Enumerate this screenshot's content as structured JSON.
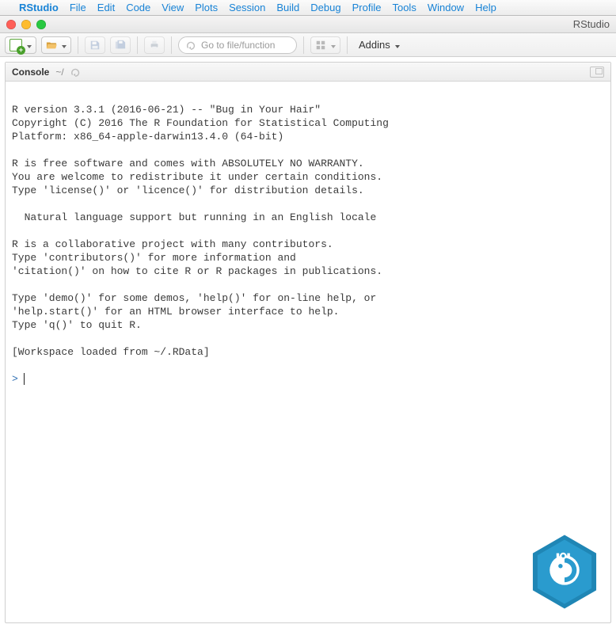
{
  "menubar": {
    "apple": "",
    "app": "RStudio",
    "items": [
      "File",
      "Edit",
      "Code",
      "View",
      "Plots",
      "Session",
      "Build",
      "Debug",
      "Profile",
      "Tools",
      "Window",
      "Help"
    ]
  },
  "window": {
    "title": "RStudio"
  },
  "toolbar": {
    "goto_placeholder": "Go to file/function",
    "addins_label": "Addins"
  },
  "console": {
    "tab_label": "Console",
    "path": "~/",
    "lines": [
      "",
      "R version 3.3.1 (2016-06-21) -- \"Bug in Your Hair\"",
      "Copyright (C) 2016 The R Foundation for Statistical Computing",
      "Platform: x86_64-apple-darwin13.4.0 (64-bit)",
      "",
      "R is free software and comes with ABSOLUTELY NO WARRANTY.",
      "You are welcome to redistribute it under certain conditions.",
      "Type 'license()' or 'licence()' for distribution details.",
      "",
      "  Natural language support but running in an English locale",
      "",
      "R is a collaborative project with many contributors.",
      "Type 'contributors()' for more information and",
      "'citation()' on how to cite R or R packages in publications.",
      "",
      "Type 'demo()' for some demos, 'help()' for on-line help, or",
      "'help.start()' for an HTML browser interface to help.",
      "Type 'q()' to quit R.",
      "",
      "[Workspace loaded from ~/.RData]",
      ""
    ],
    "prompt": ">"
  }
}
